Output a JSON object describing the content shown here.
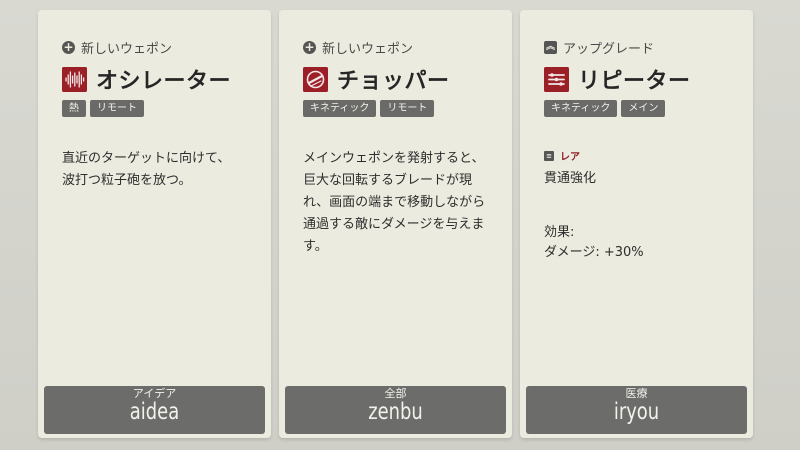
{
  "cards": [
    {
      "kind_label": "新しいウェポン",
      "kind_icon": "plus-circle-icon",
      "title": "オシレーター",
      "emblem_icon": "waveform-icon",
      "tags": [
        "熱",
        "リモート"
      ],
      "description": [
        "直近のターゲットに向けて、",
        "波打つ粒子砲を放つ。"
      ],
      "bar": {
        "japanese": "アイデア",
        "romaji": "aidea"
      }
    },
    {
      "kind_label": "新しいウェポン",
      "kind_icon": "plus-circle-icon",
      "title": "チョッパー",
      "emblem_icon": "spinning-blade-icon",
      "tags": [
        "キネティック",
        "リモート"
      ],
      "description": [
        "メインウェポンを発射すると、巨大な回転するブレードが現れ、画面の端まで移動しながら通過する敵にダメージを与えます。"
      ],
      "bar": {
        "japanese": "全部",
        "romaji": "zenbu"
      }
    },
    {
      "kind_label": "アップグレード",
      "kind_icon": "chevron-up-icon",
      "title": "リピーター",
      "emblem_icon": "repeater-icon",
      "tags": [
        "キネティック",
        "メイン"
      ],
      "rarity": "レア",
      "rarity_icon": "rarity-icon",
      "upgrade_name": "貫通強化",
      "effect_label": "効果:",
      "effect_value": "ダメージ: +30%",
      "bar": {
        "japanese": "医療",
        "romaji": "iryou"
      }
    }
  ],
  "colors": {
    "emblem": "#9b1f26",
    "rarity": "#8e1d25",
    "card": "#ecebdf",
    "bar": "#6c6c6a"
  }
}
